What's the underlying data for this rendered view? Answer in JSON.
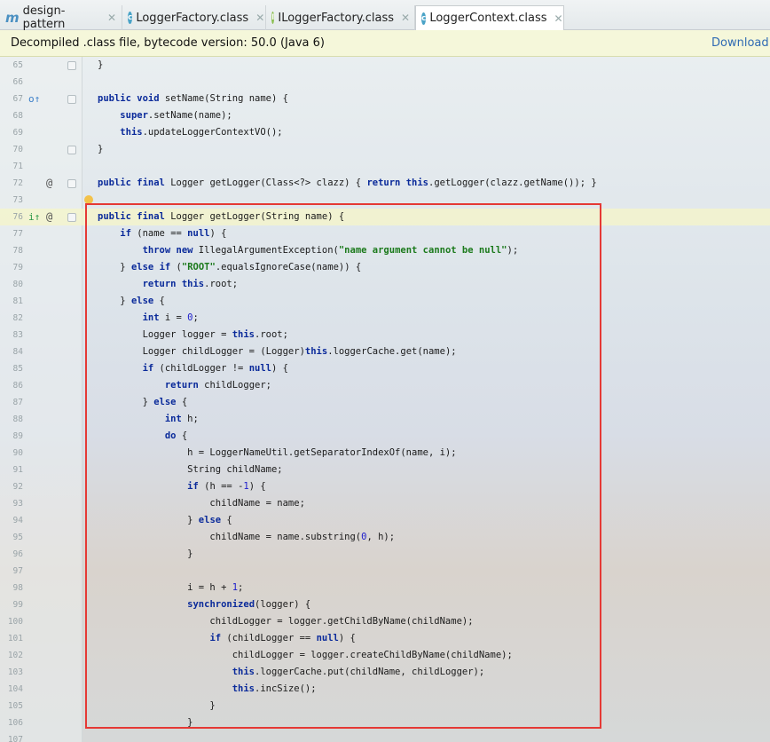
{
  "tabs": [
    {
      "label": "design-pattern",
      "icon": "maven-module-icon"
    },
    {
      "label": "LoggerFactory.class",
      "icon": "class-icon"
    },
    {
      "label": "ILoggerFactory.class",
      "icon": "interface-icon"
    },
    {
      "label": "LoggerContext.class",
      "icon": "class-icon"
    }
  ],
  "info_bar": {
    "message": "Decompiled .class file, bytecode version: 50.0 (Java 6)",
    "action": "Download S"
  },
  "highlight_color": "#e53935",
  "code_lines": [
    {
      "n": "65",
      "text": "}"
    },
    {
      "n": "66",
      "text": ""
    },
    {
      "n": "67",
      "text": "public void setName(String name) {"
    },
    {
      "n": "68",
      "text": "    super.setName(name);"
    },
    {
      "n": "69",
      "text": "    this.updateLoggerContextVO();"
    },
    {
      "n": "70",
      "text": "}"
    },
    {
      "n": "71",
      "text": ""
    },
    {
      "n": "72",
      "text": "public final Logger getLogger(Class<?> clazz) { return this.getLogger(clazz.getName()); }"
    },
    {
      "n": "73",
      "text": ""
    },
    {
      "n": "76",
      "text": "public final Logger getLogger(String name) {"
    },
    {
      "n": "77",
      "text": "    if (name == null) {"
    },
    {
      "n": "78",
      "text": "        throw new IllegalArgumentException(\"name argument cannot be null\");"
    },
    {
      "n": "79",
      "text": "    } else if (\"ROOT\".equalsIgnoreCase(name)) {"
    },
    {
      "n": "80",
      "text": "        return this.root;"
    },
    {
      "n": "81",
      "text": "    } else {"
    },
    {
      "n": "82",
      "text": "        int i = 0;"
    },
    {
      "n": "83",
      "text": "        Logger logger = this.root;"
    },
    {
      "n": "84",
      "text": "        Logger childLogger = (Logger)this.loggerCache.get(name);"
    },
    {
      "n": "85",
      "text": "        if (childLogger != null) {"
    },
    {
      "n": "86",
      "text": "            return childLogger;"
    },
    {
      "n": "87",
      "text": "        } else {"
    },
    {
      "n": "88",
      "text": "            int h;"
    },
    {
      "n": "89",
      "text": "            do {"
    },
    {
      "n": "90",
      "text": "                h = LoggerNameUtil.getSeparatorIndexOf(name, i);"
    },
    {
      "n": "91",
      "text": "                String childName;"
    },
    {
      "n": "92",
      "text": "                if (h == -1) {"
    },
    {
      "n": "93",
      "text": "                    childName = name;"
    },
    {
      "n": "94",
      "text": "                } else {"
    },
    {
      "n": "95",
      "text": "                    childName = name.substring(0, h);"
    },
    {
      "n": "96",
      "text": "                }"
    },
    {
      "n": "97",
      "text": ""
    },
    {
      "n": "98",
      "text": "                i = h + 1;"
    },
    {
      "n": "99",
      "text": "                synchronized(logger) {"
    },
    {
      "n": "100",
      "text": "                    childLogger = logger.getChildByName(childName);"
    },
    {
      "n": "101",
      "text": "                    if (childLogger == null) {"
    },
    {
      "n": "102",
      "text": "                        childLogger = logger.createChildByName(childName);"
    },
    {
      "n": "103",
      "text": "                        this.loggerCache.put(childName, childLogger);"
    },
    {
      "n": "104",
      "text": "                        this.incSize();"
    },
    {
      "n": "105",
      "text": "                    }"
    },
    {
      "n": "106",
      "text": "                }"
    },
    {
      "n": "107",
      "text": ""
    }
  ]
}
